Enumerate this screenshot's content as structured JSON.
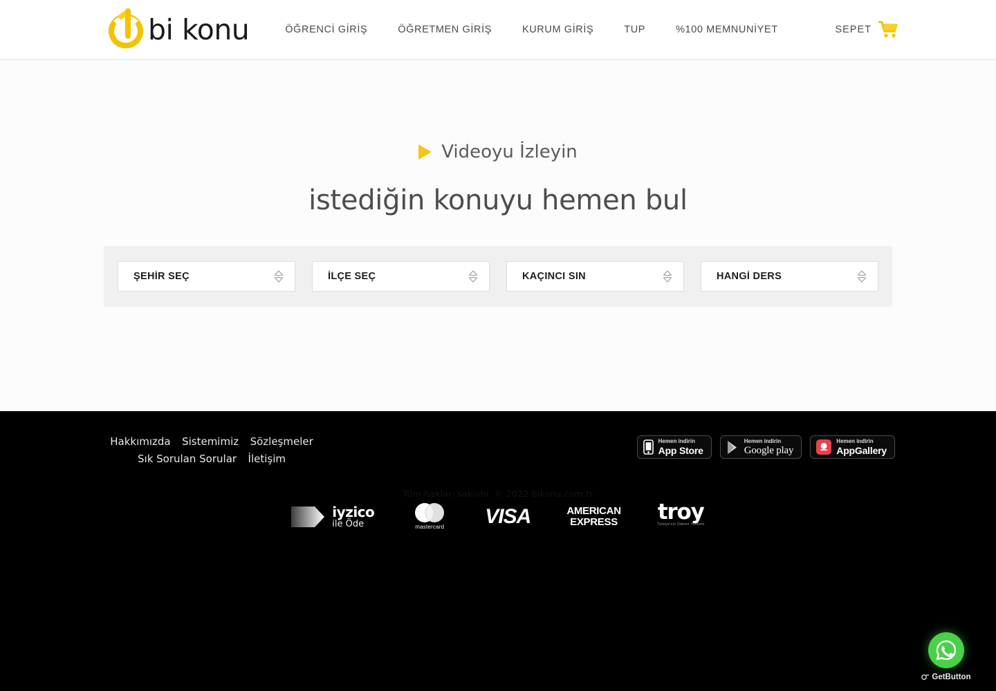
{
  "header": {
    "logo_text": "bi konu",
    "logo_icon": "power-one-logo-icon",
    "nav": [
      {
        "label": "ÖĞRENCİ GİRİŞ",
        "name": "nav-ogrenci-giris"
      },
      {
        "label": "ÖĞRETMEN GİRİŞ",
        "name": "nav-ogretmen-giris"
      },
      {
        "label": "KURUM GİRİŞ",
        "name": "nav-kurum-giris"
      },
      {
        "label": "TUP",
        "name": "nav-tup"
      },
      {
        "label": "%100 MEMNUNİYET",
        "name": "nav-memnuniyet"
      }
    ],
    "cart_label": "SEPET",
    "cart_icon": "shopping-cart-icon"
  },
  "hero": {
    "video_cta": "Videoyu İzleyin",
    "play_icon": "play-triangle-icon",
    "title": "istediğin konuyu hemen bul"
  },
  "search": {
    "selects": [
      {
        "value": "ŞEHİR SEÇ",
        "name": "select-sehir"
      },
      {
        "value": "İLÇE SEÇ",
        "name": "select-ilce"
      },
      {
        "value": "KAÇINCI SIN",
        "name": "select-sinif"
      },
      {
        "value": "HANGİ DERS",
        "name": "select-ders"
      }
    ]
  },
  "footer": {
    "links": [
      {
        "label": "Hakkımızda",
        "name": "footer-link-hakkimizda"
      },
      {
        "label": "Sistemimiz",
        "name": "footer-link-sistemimiz"
      },
      {
        "label": "Sözleşmeler",
        "name": "footer-link-sozlesmeler"
      },
      {
        "label": "Sık Sorulan Sorular",
        "name": "footer-link-sss"
      },
      {
        "label": "İletişim",
        "name": "footer-link-iletisim"
      }
    ],
    "store_badges": [
      {
        "small": "Hemen indirin",
        "big": "App Store",
        "icon": "apple-phone-icon",
        "name": "badge-app-store"
      },
      {
        "small": "Hemen indirin",
        "big": "Google play",
        "icon": "google-play-icon",
        "name": "badge-google-play"
      },
      {
        "small": "Hemen indirin",
        "big": "AppGallery",
        "icon": "huawei-appgallery-icon",
        "name": "badge-appgallery"
      }
    ],
    "copyright": "Tüm hakları saklıdır. © 2022 bikonu.com.tr",
    "payments": {
      "iyzico_name": "iyzico",
      "iyzico_sub": "ile Öde",
      "mastercard_label": "mastercard",
      "visa_label": "VISA",
      "amex_line1": "AMERICAN",
      "amex_line2": "EXPRESS",
      "troy_label": "troy",
      "troy_sub": "Türkiye'nin Ödeme Yöntemi"
    }
  },
  "widget": {
    "icon": "whatsapp-icon",
    "brand": "GetButton",
    "brand_icon": "getbutton-logo-icon"
  },
  "colors": {
    "brand_yellow": "#f5c518",
    "footer_bg": "#000000",
    "panel_bg": "#f0f0f0",
    "whatsapp_green": "#4ad04a"
  }
}
